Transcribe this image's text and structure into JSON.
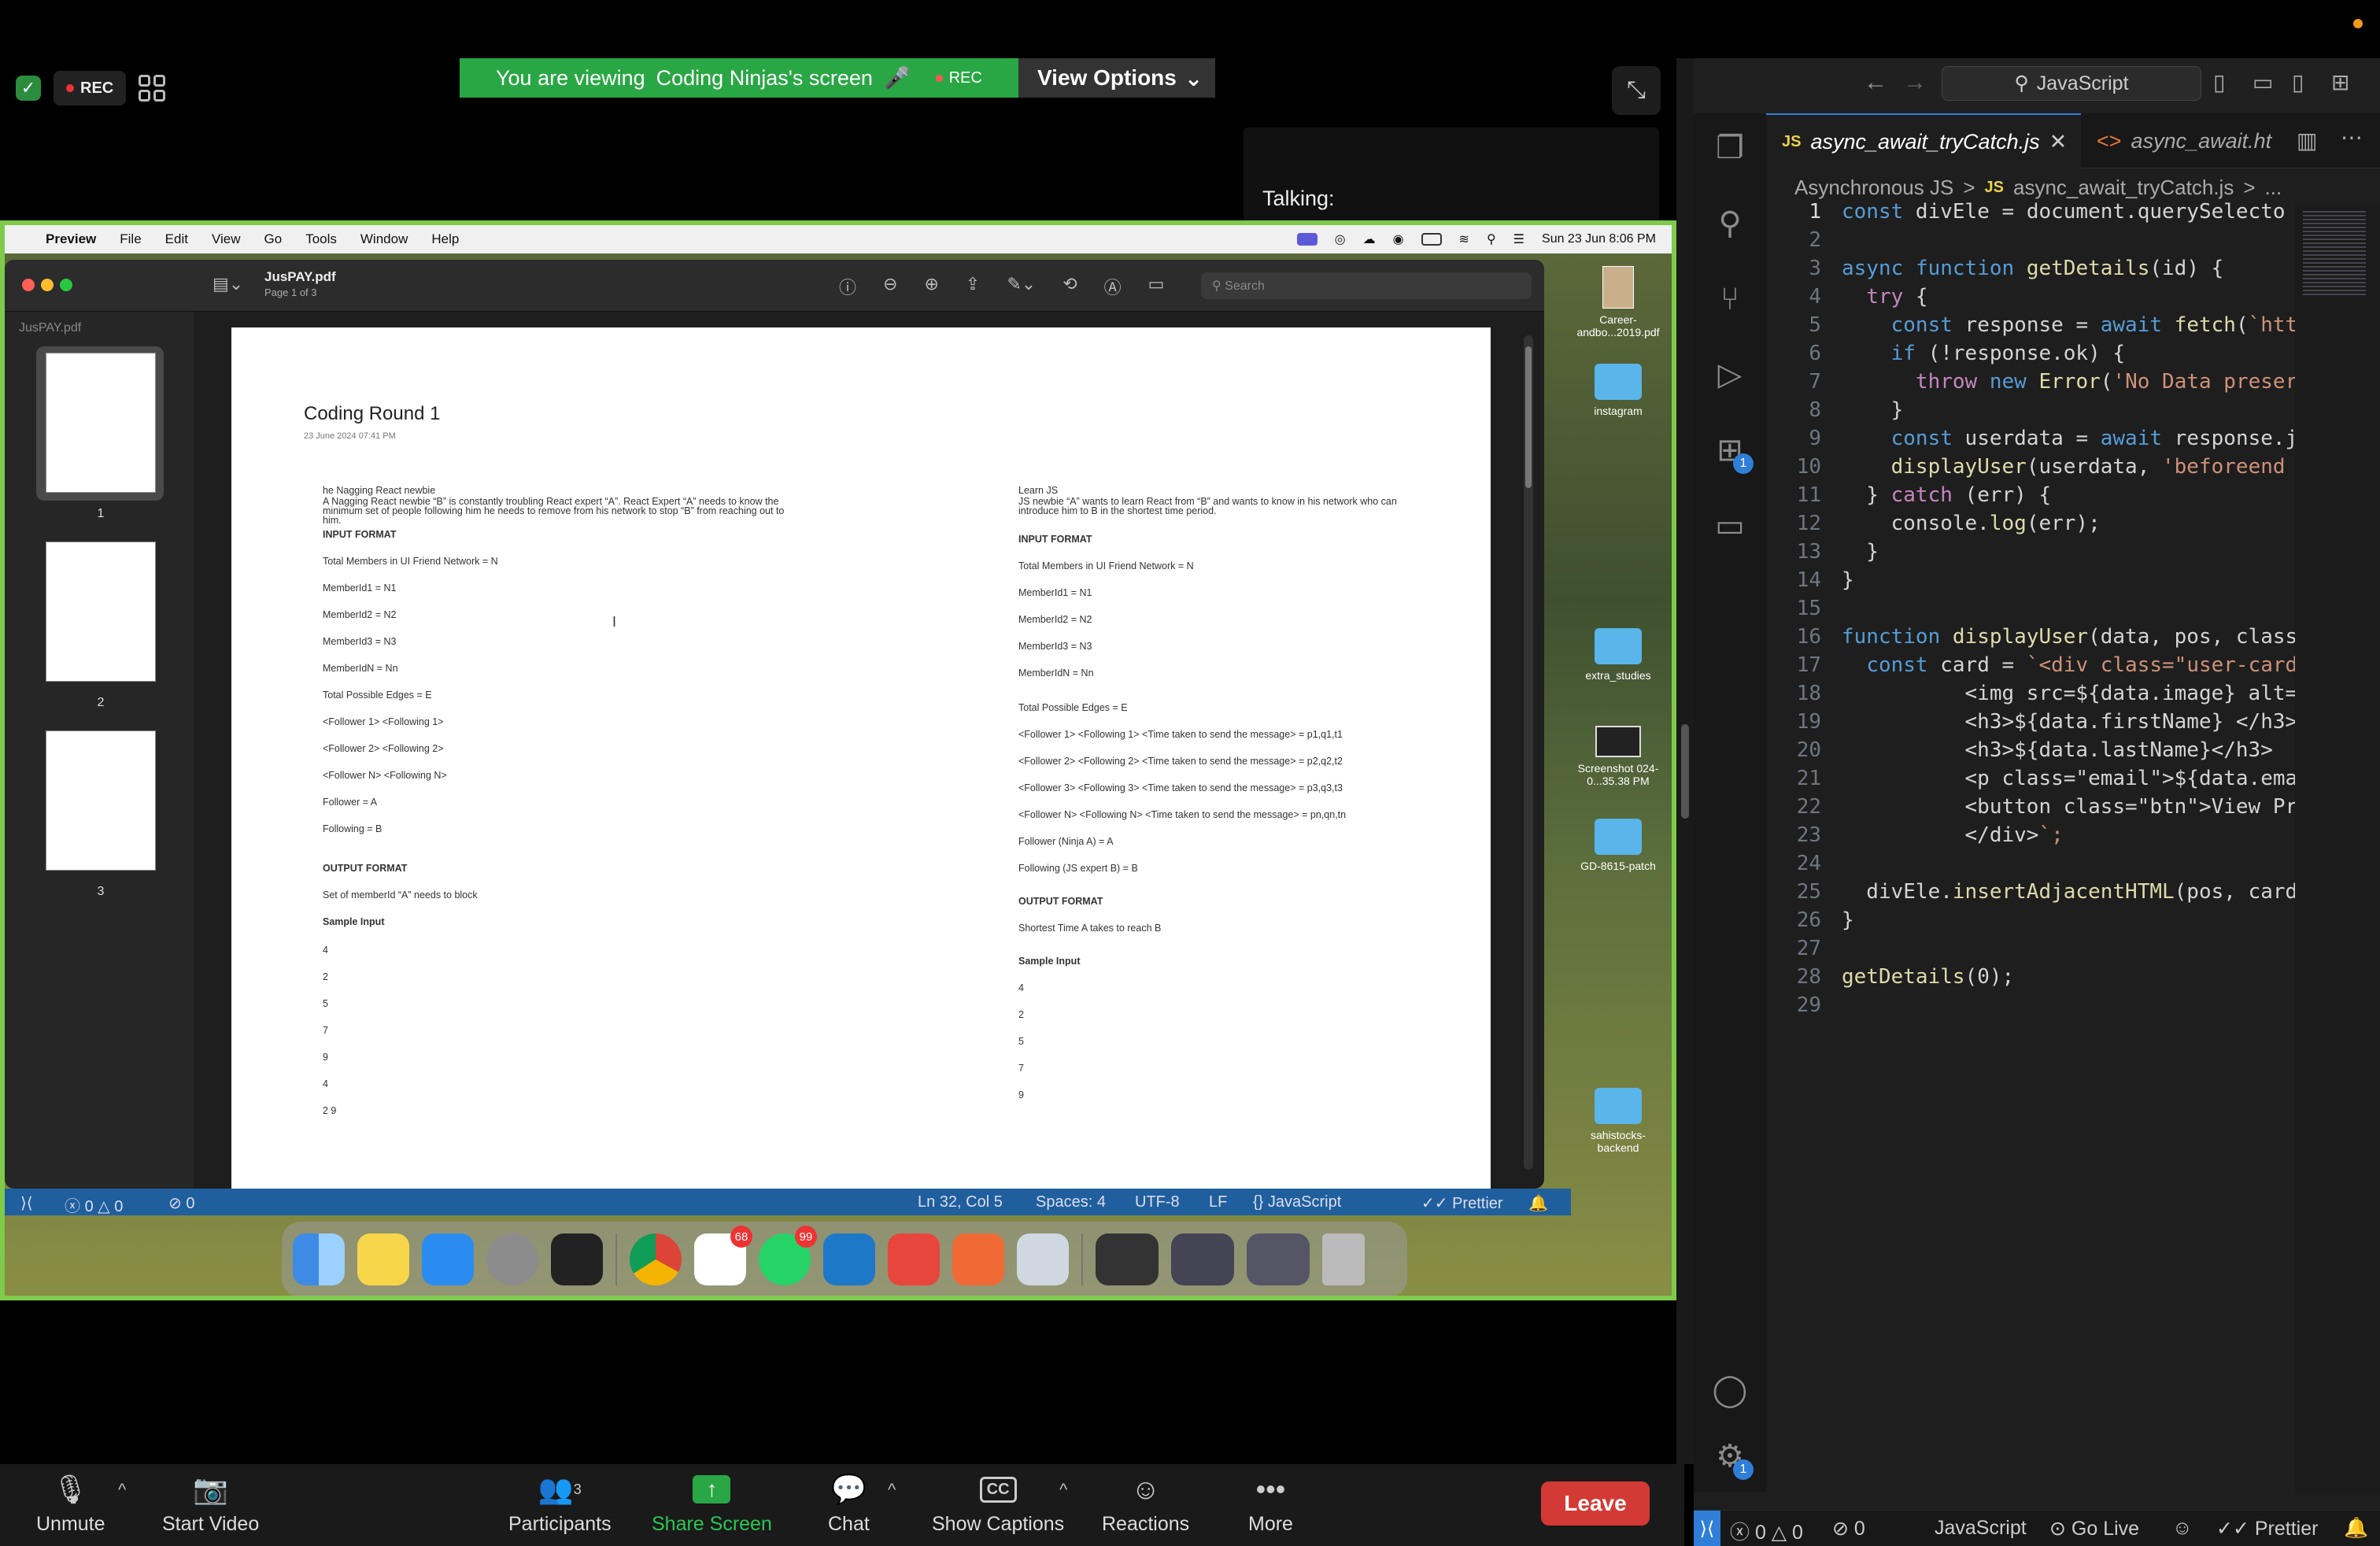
{
  "zoom": {
    "rec_label": "REC",
    "banner": {
      "prefix": "You are viewing",
      "name": "Coding Ninjas's screen",
      "rec": "REC"
    },
    "view_options": "View Options",
    "talking": "Talking:",
    "toolbar": {
      "unmute": "Unmute",
      "start_video": "Start Video",
      "participants": "Participants",
      "participants_count": "3",
      "share_screen": "Share Screen",
      "chat": "Chat",
      "show_captions": "Show Captions",
      "reactions": "Reactions",
      "more": "More",
      "leave": "Leave"
    },
    "colors": {
      "share_green": "#29a744",
      "leave_red": "#d33a36",
      "border_green": "#7ecb4a"
    }
  },
  "mac": {
    "menubar": [
      "Preview",
      "File",
      "Edit",
      "View",
      "Go",
      "Tools",
      "Window",
      "Help"
    ],
    "clock": "Sun 23 Jun  8:06 PM",
    "desktop": [
      {
        "label": "Career-andbo...2019.pdf"
      },
      {
        "label": "instagram"
      },
      {
        "label": "extra_studies"
      },
      {
        "label": "Screenshot 024-0...35.38 PM"
      },
      {
        "label": "GD-8615-patch"
      },
      {
        "label": "sahistocks-backend"
      }
    ],
    "dock_badges": {
      "slack": "68",
      "whatsapp": "99"
    }
  },
  "preview": {
    "title": "JusPAY.pdf",
    "subtitle": "Page 1 of 3",
    "search_placeholder": "Search",
    "sidebar_name": "JusPAY.pdf",
    "pages": [
      "1",
      "2",
      "3"
    ],
    "doc": {
      "title": "Coding Round 1",
      "date": "23 June 2024      07:41 PM",
      "left": [
        "he Nagging React newbie",
        "A Nagging React newbie “B” is constantly troubling React expert “A”. React Expert “A” needs to know the",
        "minimum set of people following him he needs to remove from his network to stop “B” from reaching out to",
        "him.",
        "INPUT FORMAT",
        "Total Members in UI Friend Network = N",
        "MemberId1 = N1",
        "MemberId2 = N2",
        "MemberId3 = N3",
        "MemberIdN = Nn",
        "Total Possible Edges = E",
        "<Follower 1> <Following 1>",
        "<Follower 2> <Following 2>",
        "<Follower N> <Following N>",
        "Follower = A",
        "Following = B",
        "OUTPUT FORMAT",
        "Set of memberId “A” needs to block",
        "Sample Input",
        "4",
        "2",
        "5",
        "7",
        "9",
        "4",
        "2 9"
      ],
      "right": [
        "Learn JS",
        "JS newbie “A” wants to learn React from “B” and wants to know in his network who can",
        "introduce him to B in the shortest time period.",
        "INPUT FORMAT",
        "Total Members in UI Friend Network = N",
        "MemberId1 = N1",
        "MemberId2 = N2",
        "MemberId3 = N3",
        "MemberIdN = Nn",
        "Total Possible Edges = E",
        "<Follower 1> <Following 1> <Time taken to send the message> = p1,q1,t1",
        "<Follower 2> <Following 2> <Time taken to send the message> = p2,q2,t2",
        "<Follower 3> <Following 3> <Time taken to send the message> = p3,q3,t3",
        "<Follower N> <Following N> <Time taken to send the message> = pn,qn,tn",
        "Follower (Ninja A) = A",
        "Following (JS expert B) = B",
        "OUTPUT FORMAT",
        "Shortest Time A takes to reach B",
        "Sample Input",
        "4",
        "2",
        "5",
        "7",
        "9"
      ]
    },
    "statusbar": {
      "errors": "0",
      "warnings": "0",
      "ports": "0",
      "position": "Ln 32, Col 5",
      "spaces": "Spaces: 4",
      "encoding": "UTF-8",
      "eol": "LF",
      "language": "JavaScript",
      "formatter": "Prettier"
    }
  },
  "vscode": {
    "search": "JavaScript",
    "tabs": [
      {
        "icon": "JS",
        "label": "async_await_tryCatch.js",
        "active": true
      },
      {
        "icon": "<>",
        "label": "async_await.ht",
        "active": false
      }
    ],
    "breadcrumb": [
      "Asynchronous JS",
      ">",
      "JS",
      "async_await_tryCatch.js",
      ">",
      "..."
    ],
    "current_line": 1,
    "lines": [
      "const divEle = document.querySelecto",
      "",
      "async function getDetails(id) {",
      "  try {",
      "    const response = await fetch(`htt",
      "    if (!response.ok) {",
      "      throw new Error('No Data preser",
      "    }",
      "    const userdata = await response.j",
      "    displayUser(userdata, 'beforeend",
      "  } catch (err) {",
      "    console.log(err);",
      "  }",
      "}",
      "",
      "function displayUser(data, pos, class",
      "  const card = `<div class=\"user-card",
      "          <img src=${data.image} alt=",
      "          <h3>${data.firstName} </h3>",
      "          <h3>${data.lastName}</h3>",
      "          <p class=\"email\">${data.ema",
      "          <button class=\"btn\">View Pr",
      "          </div>`;",
      "",
      "  divEle.insertAdjacentHTML(pos, card",
      "}",
      "",
      "getDetails(0);",
      ""
    ],
    "activity_badges": {
      "extensions": "1",
      "settings": "1"
    },
    "status": {
      "errors": "0",
      "warnings": "0",
      "ports": "0",
      "language": "JavaScript",
      "golive": "Go Live",
      "formatter": "Prettier"
    }
  }
}
